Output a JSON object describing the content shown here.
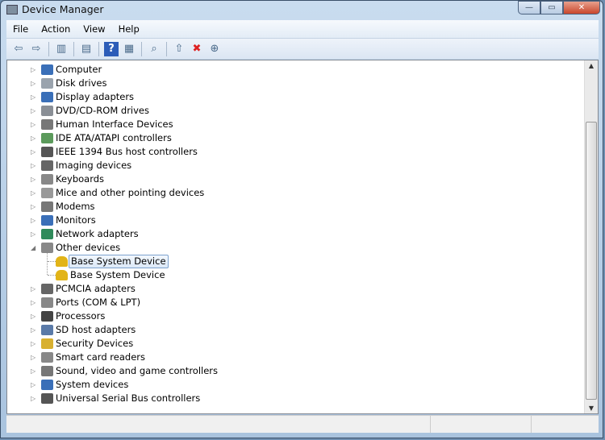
{
  "window": {
    "title": "Device Manager",
    "minimize": "—",
    "maximize": "▭",
    "close": "✕"
  },
  "menu": [
    "File",
    "Action",
    "View",
    "Help"
  ],
  "toolbar": [
    {
      "name": "back-icon",
      "glyph": "⇦"
    },
    {
      "name": "forward-icon",
      "glyph": "⇨"
    },
    {
      "sep": true
    },
    {
      "name": "show-hide-console-tree-icon",
      "glyph": "▥"
    },
    {
      "sep": true
    },
    {
      "name": "properties-icon",
      "glyph": "▤"
    },
    {
      "sep": true
    },
    {
      "name": "help-icon",
      "glyph": "?"
    },
    {
      "name": "action-pane-icon",
      "glyph": "▦"
    },
    {
      "sep": true
    },
    {
      "name": "scan-hardware-icon",
      "glyph": "⌕"
    },
    {
      "sep": true
    },
    {
      "name": "update-driver-icon",
      "glyph": "⇧"
    },
    {
      "name": "uninstall-icon",
      "glyph": "✖"
    },
    {
      "name": "enable-device-icon",
      "glyph": "⊕"
    }
  ],
  "tree": [
    {
      "label": "Computer",
      "color": "#3a6fb8"
    },
    {
      "label": "Disk drives",
      "color": "#9aa3ad"
    },
    {
      "label": "Display adapters",
      "color": "#3a6fb8"
    },
    {
      "label": "DVD/CD-ROM drives",
      "color": "#8a8f96"
    },
    {
      "label": "Human Interface Devices",
      "color": "#777"
    },
    {
      "label": "IDE ATA/ATAPI controllers",
      "color": "#5b9a5b"
    },
    {
      "label": "IEEE 1394 Bus host controllers",
      "color": "#555"
    },
    {
      "label": "Imaging devices",
      "color": "#666"
    },
    {
      "label": "Keyboards",
      "color": "#888"
    },
    {
      "label": "Mice and other pointing devices",
      "color": "#999"
    },
    {
      "label": "Modems",
      "color": "#777"
    },
    {
      "label": "Monitors",
      "color": "#3a6fb8"
    },
    {
      "label": "Network adapters",
      "color": "#2f8a5a"
    },
    {
      "label": "Other devices",
      "color": "#888",
      "expanded": true,
      "children": [
        {
          "label": "Base System Device",
          "selected": true,
          "color": "#e2b418"
        },
        {
          "label": "Base System Device",
          "color": "#e2b418"
        }
      ]
    },
    {
      "label": "PCMCIA adapters",
      "color": "#666"
    },
    {
      "label": "Ports (COM & LPT)",
      "color": "#888"
    },
    {
      "label": "Processors",
      "color": "#444"
    },
    {
      "label": "SD host adapters",
      "color": "#5a7aa8"
    },
    {
      "label": "Security Devices",
      "color": "#d8b030"
    },
    {
      "label": "Smart card readers",
      "color": "#888"
    },
    {
      "label": "Sound, video and game controllers",
      "color": "#777"
    },
    {
      "label": "System devices",
      "color": "#3a6fb8"
    },
    {
      "label": "Universal Serial Bus controllers",
      "color": "#555"
    }
  ]
}
